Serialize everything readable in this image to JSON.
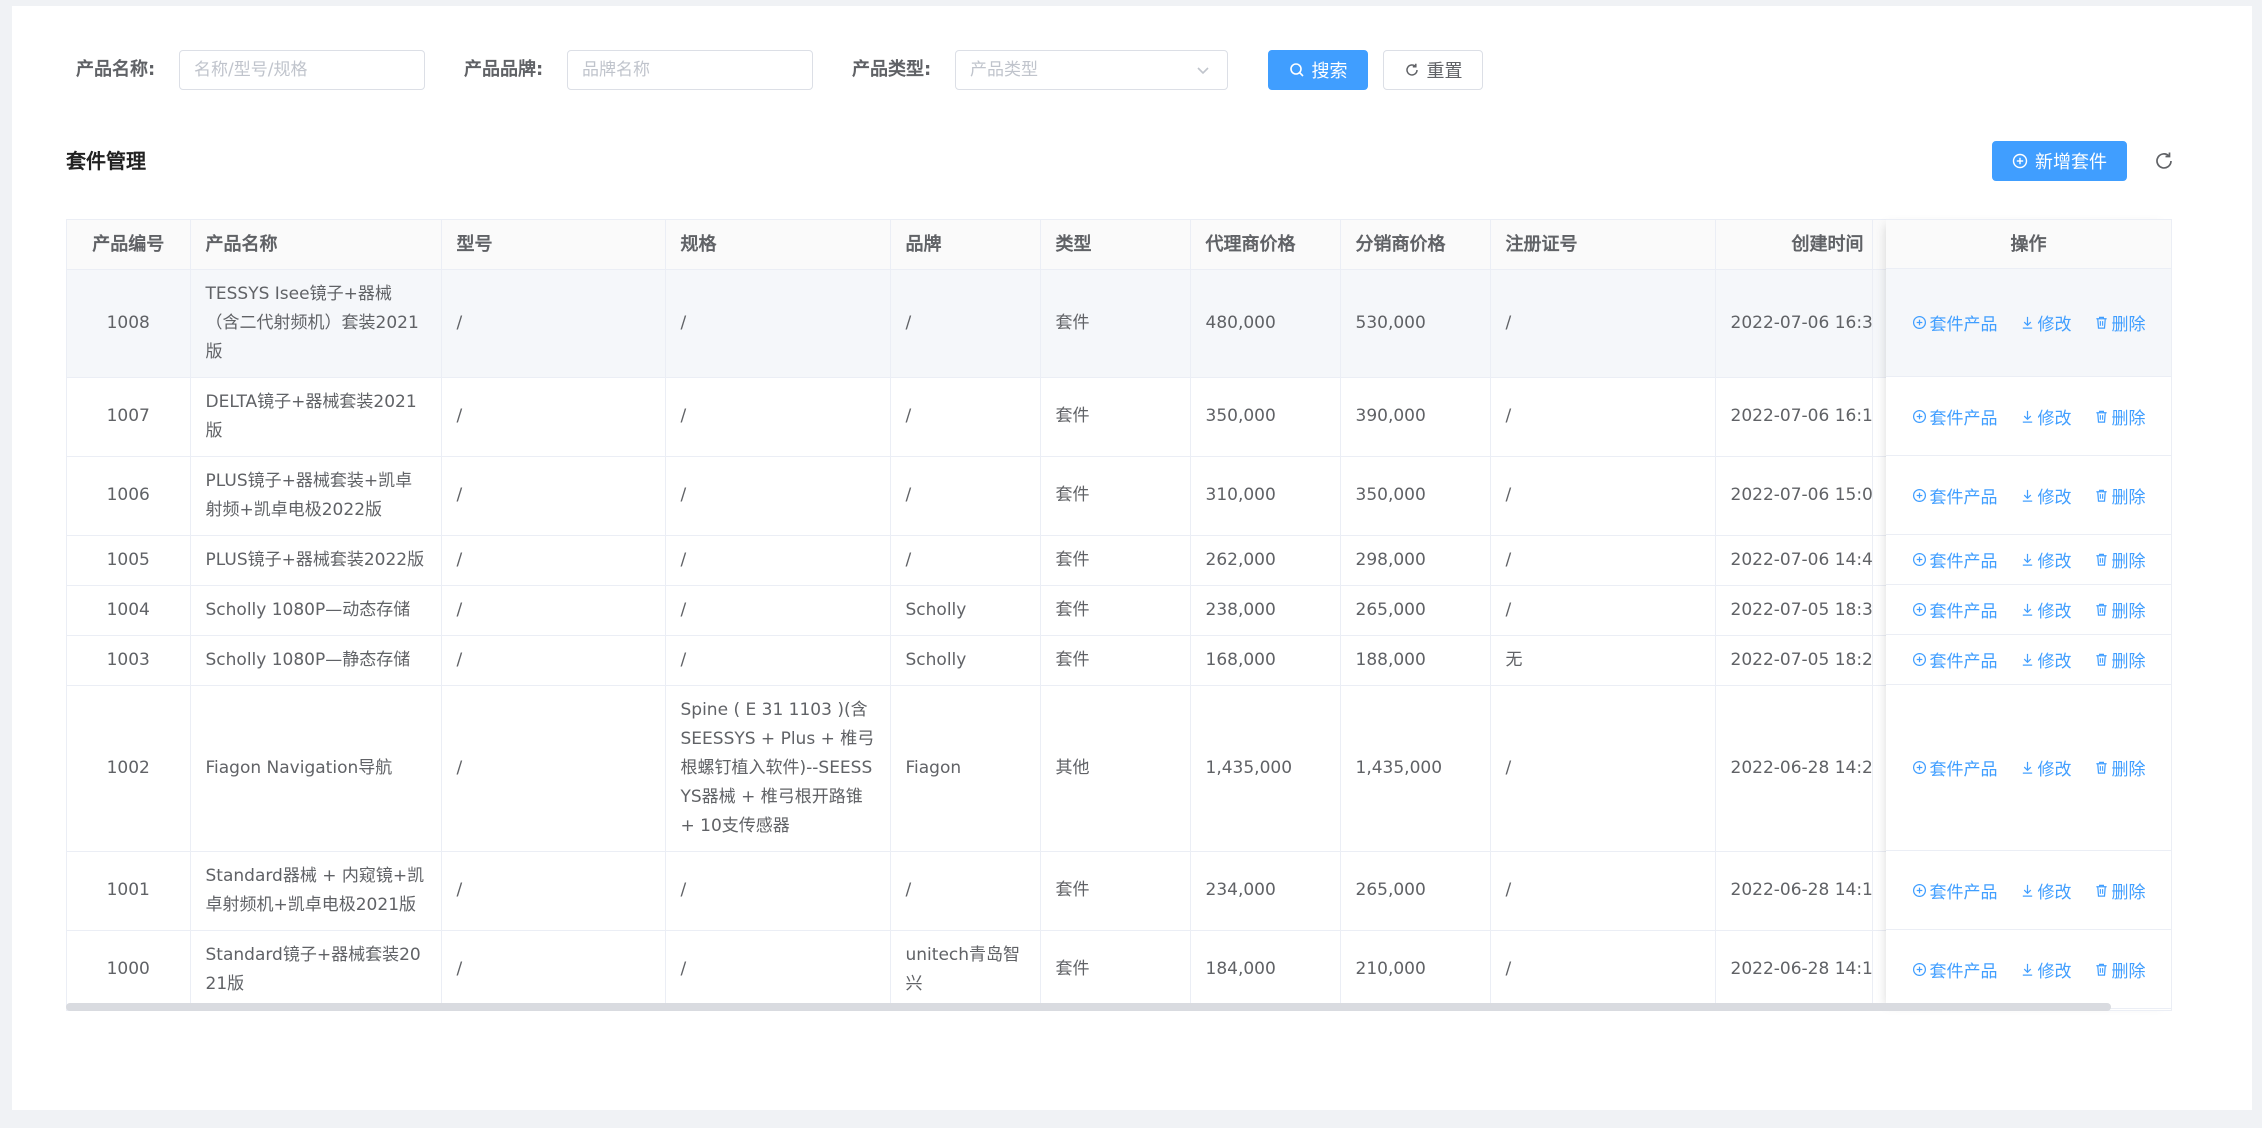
{
  "search": {
    "name_label": "产品名称:",
    "name_placeholder": "名称/型号/规格",
    "brand_label": "产品品牌:",
    "brand_placeholder": "品牌名称",
    "type_label": "产品类型:",
    "type_placeholder": "产品类型",
    "search_button": "搜索",
    "reset_button": "重置"
  },
  "section": {
    "title": "套件管理",
    "add_button": "新增套件"
  },
  "table": {
    "headers": {
      "id": "产品编号",
      "name": "产品名称",
      "model": "型号",
      "spec": "规格",
      "brand": "品牌",
      "type": "类型",
      "agent_price": "代理商价格",
      "dist_price": "分销商价格",
      "reg_no": "注册证号",
      "created": "创建时间",
      "ops": "操作"
    },
    "actions": {
      "kit": "套件产品",
      "edit": "修改",
      "delete": "删除"
    },
    "rows": [
      {
        "id": "1008",
        "name": "TESSYS Isee镜子+器械（含二代射频机）套装2021版",
        "model": "/",
        "spec": "/",
        "brand": "/",
        "type": "套件",
        "agent_price": "480,000",
        "dist_price": "530,000",
        "reg_no": "/",
        "created": "2022-07-06 16:3"
      },
      {
        "id": "1007",
        "name": "DELTA镜子+器械套装2021版",
        "model": "/",
        "spec": "/",
        "brand": "/",
        "type": "套件",
        "agent_price": "350,000",
        "dist_price": "390,000",
        "reg_no": "/",
        "created": "2022-07-06 16:1"
      },
      {
        "id": "1006",
        "name": "PLUS镜子+器械套装+凯卓射频+凯卓电极2022版",
        "model": "/",
        "spec": "/",
        "brand": "/",
        "type": "套件",
        "agent_price": "310,000",
        "dist_price": "350,000",
        "reg_no": "/",
        "created": "2022-07-06 15:0"
      },
      {
        "id": "1005",
        "name": "PLUS镜子+器械套装2022版",
        "model": "/",
        "spec": "/",
        "brand": "/",
        "type": "套件",
        "agent_price": "262,000",
        "dist_price": "298,000",
        "reg_no": "/",
        "created": "2022-07-06 14:4"
      },
      {
        "id": "1004",
        "name": "Scholly 1080P—动态存储",
        "model": "/",
        "spec": "/",
        "brand": "Scholly",
        "type": "套件",
        "agent_price": "238,000",
        "dist_price": "265,000",
        "reg_no": "/",
        "created": "2022-07-05 18:3"
      },
      {
        "id": "1003",
        "name": "Scholly 1080P—静态存储",
        "model": "/",
        "spec": "/",
        "brand": "Scholly",
        "type": "套件",
        "agent_price": "168,000",
        "dist_price": "188,000",
        "reg_no": "无",
        "created": "2022-07-05 18:2"
      },
      {
        "id": "1002",
        "name": "Fiagon Navigation导航",
        "model": "/",
        "spec": "Spine ( E 31 1103 )(含SEESSYS + Plus + 椎弓根螺钉植入软件)--SEESSYS器械 + 椎弓根开路锥 + 10支传感器",
        "brand": "Fiagon",
        "type": "其他",
        "agent_price": "1,435,000",
        "dist_price": "1,435,000",
        "reg_no": "/",
        "created": "2022-06-28 14:2"
      },
      {
        "id": "1001",
        "name": "Standard器械 + 内窥镜+凯卓射频机+凯卓电极2021版",
        "model": "/",
        "spec": "/",
        "brand": "/",
        "type": "套件",
        "agent_price": "234,000",
        "dist_price": "265,000",
        "reg_no": "/",
        "created": "2022-06-28 14:1"
      },
      {
        "id": "1000",
        "name": "Standard镜子+器械套装2021版",
        "model": "/",
        "spec": "/",
        "brand": "unitech青岛智兴",
        "type": "套件",
        "agent_price": "184,000",
        "dist_price": "210,000",
        "reg_no": "/",
        "created": "2022-06-28 14:1"
      }
    ]
  }
}
